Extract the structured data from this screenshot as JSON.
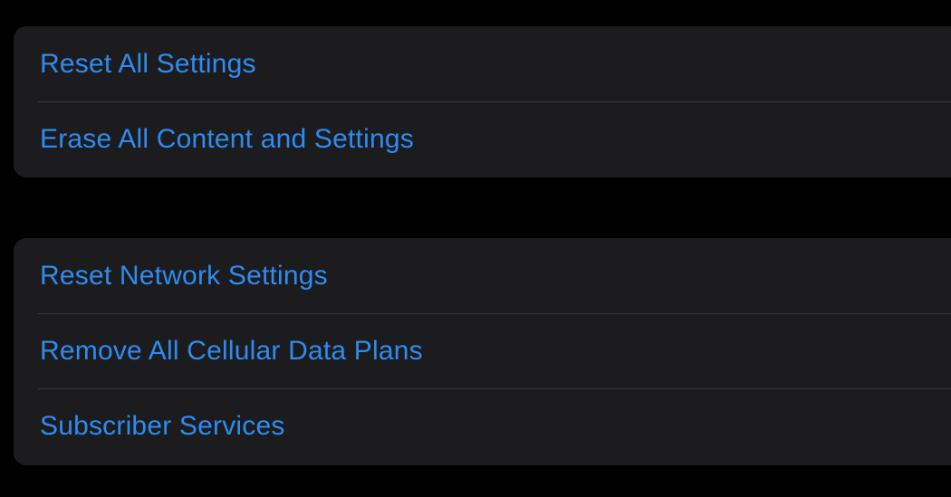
{
  "colors": {
    "background": "#000000",
    "group_background": "#1c1c1e",
    "separator": "#38383a",
    "action_text": "#2f8bf0"
  },
  "groups": [
    {
      "items": [
        {
          "label": "Reset All Settings"
        },
        {
          "label": "Erase All Content and Settings"
        }
      ]
    },
    {
      "items": [
        {
          "label": "Reset Network Settings"
        },
        {
          "label": "Remove All Cellular Data Plans"
        },
        {
          "label": "Subscriber Services"
        }
      ]
    }
  ]
}
